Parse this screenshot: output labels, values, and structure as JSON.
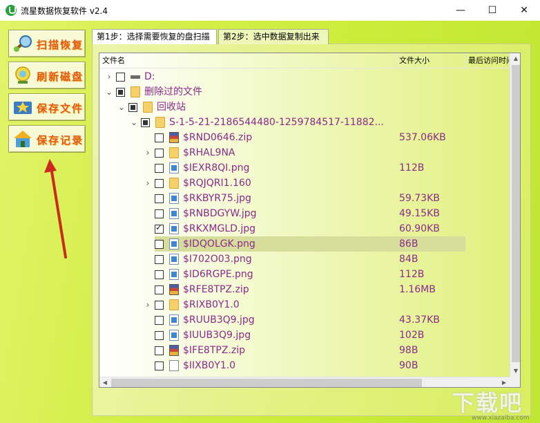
{
  "window": {
    "title": "流星数据恢复软件 v2.4",
    "minimize_glyph": "—",
    "maximize_glyph": "☐",
    "close_glyph": "✕"
  },
  "sidebar": {
    "items": [
      {
        "label": "扫描恢复",
        "icon": "scan-magnifier-icon"
      },
      {
        "label": "刷新磁盘",
        "icon": "refresh-disk-icon"
      },
      {
        "label": "保存文件",
        "icon": "save-file-icon"
      },
      {
        "label": "保存记录",
        "icon": "save-record-icon"
      }
    ]
  },
  "tabs": [
    {
      "label": "第1步：选择需要恢复的盘扫描",
      "active": true
    },
    {
      "label": "第2步：选中数据复制出来",
      "active": false
    }
  ],
  "tree": {
    "columns": [
      "文件名",
      "文件大小",
      "最后访问时间"
    ],
    "rows": [
      {
        "name": "D:",
        "size": "",
        "level": 0,
        "expander": "›",
        "check": "none",
        "icon": "drive-icon"
      },
      {
        "name": "删除过的文件",
        "size": "",
        "level": 0,
        "expander": "⌄",
        "check": "partial",
        "icon": "folder-icon"
      },
      {
        "name": "回收站",
        "size": "",
        "level": 1,
        "expander": "⌄",
        "check": "partial",
        "icon": "folder-icon"
      },
      {
        "name": "S-1-5-21-2186544480-1259784517-11882...",
        "size": "",
        "level": 2,
        "expander": "⌄",
        "check": "partial",
        "icon": "folder-icon"
      },
      {
        "name": "$RND0646.zip",
        "size": "537.06KB",
        "level": 3,
        "expander": "",
        "check": "none",
        "icon": "zip-icon"
      },
      {
        "name": "$RHAL9NA",
        "size": "",
        "level": 3,
        "expander": "›",
        "check": "none",
        "icon": "folder-icon"
      },
      {
        "name": "$IEXR8QI.png",
        "size": "112B",
        "level": 3,
        "expander": "",
        "check": "none",
        "icon": "image-icon"
      },
      {
        "name": "$RQJQRI1.160",
        "size": "",
        "level": 3,
        "expander": "›",
        "check": "none",
        "icon": "folder-icon"
      },
      {
        "name": "$RKBYR75.jpg",
        "size": "59.73KB",
        "level": 3,
        "expander": "",
        "check": "none",
        "icon": "image-icon"
      },
      {
        "name": "$RNBDGYW.jpg",
        "size": "49.15KB",
        "level": 3,
        "expander": "",
        "check": "none",
        "icon": "image-icon"
      },
      {
        "name": "$RKXMGLD.jpg",
        "size": "60.90KB",
        "level": 3,
        "expander": "",
        "check": "checked",
        "icon": "image-icon"
      },
      {
        "name": "$IDQOLGK.png",
        "size": "86B",
        "level": 3,
        "expander": "",
        "check": "none",
        "icon": "image-icon",
        "selected": true
      },
      {
        "name": "$I702O03.png",
        "size": "84B",
        "level": 3,
        "expander": "",
        "check": "none",
        "icon": "image-icon"
      },
      {
        "name": "$ID6RGPE.png",
        "size": "112B",
        "level": 3,
        "expander": "",
        "check": "none",
        "icon": "image-icon"
      },
      {
        "name": "$RFE8TPZ.zip",
        "size": "1.16MB",
        "level": 3,
        "expander": "",
        "check": "none",
        "icon": "zip-icon"
      },
      {
        "name": "$RIXB0Y1.0",
        "size": "",
        "level": 3,
        "expander": "›",
        "check": "none",
        "icon": "folder-icon"
      },
      {
        "name": "$RUUB3Q9.jpg",
        "size": "43.37KB",
        "level": 3,
        "expander": "",
        "check": "none",
        "icon": "image-icon"
      },
      {
        "name": "$IUUB3Q9.jpg",
        "size": "102B",
        "level": 3,
        "expander": "",
        "check": "none",
        "icon": "image-icon"
      },
      {
        "name": "$IFE8TPZ.zip",
        "size": "98B",
        "level": 3,
        "expander": "",
        "check": "none",
        "icon": "zip-icon"
      },
      {
        "name": "$IIXB0Y1.0",
        "size": "90B",
        "level": 3,
        "expander": "",
        "check": "none",
        "icon": "file-icon"
      }
    ]
  },
  "scroll": {
    "up": "▲",
    "down": "▼",
    "left": "◀",
    "right": "▶"
  },
  "watermark": {
    "big": "下载吧",
    "small": "www.xiazaiba.com"
  },
  "colors": {
    "accent_text": "#8a2a8a",
    "sidebar_label": "#e55a18",
    "annotation_arrow": "#cc2a1c"
  }
}
